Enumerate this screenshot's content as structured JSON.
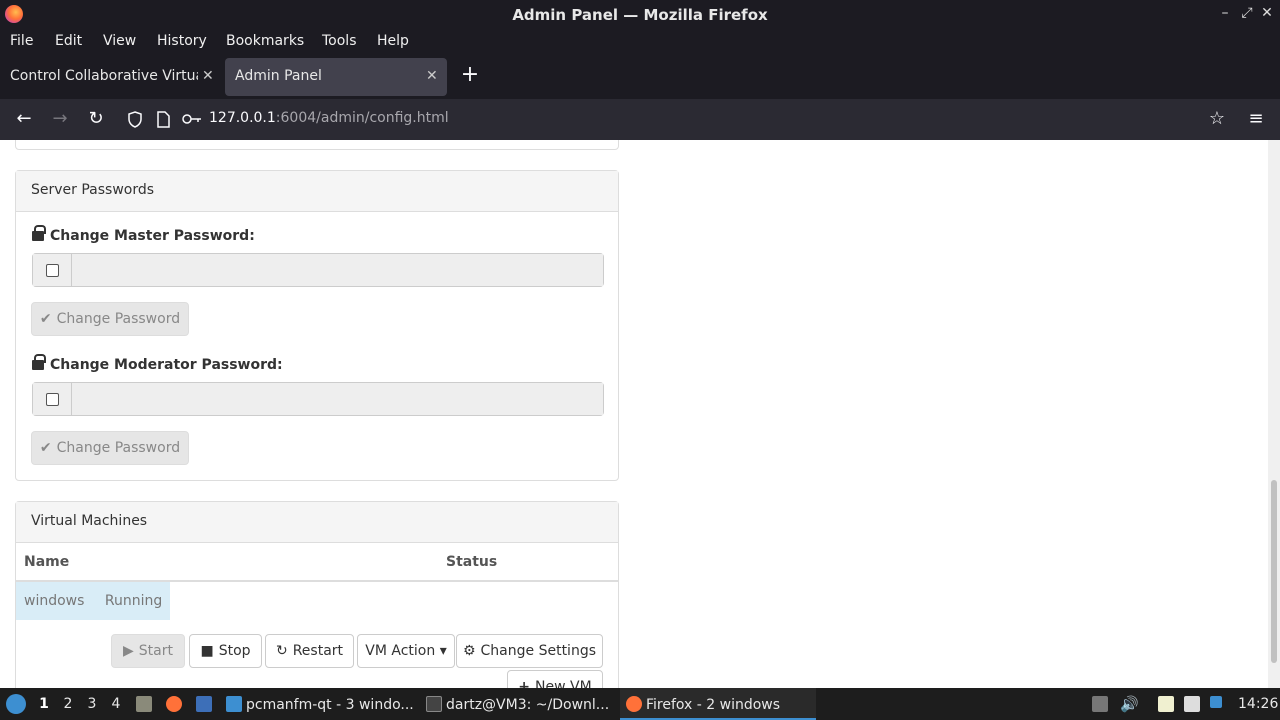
{
  "window": {
    "title": "Admin Panel — Mozilla Firefox",
    "minimize_glyph": "–",
    "maximize_glyph": "⤢",
    "close_glyph": "✕"
  },
  "menu": [
    "File",
    "Edit",
    "View",
    "History",
    "Bookmarks",
    "Tools",
    "Help"
  ],
  "tabs": [
    {
      "label": "Control Collaborative Virtual Machines",
      "close": "✕"
    },
    {
      "label": "Admin Panel",
      "close": "✕"
    }
  ],
  "new_tab_glyph": "+",
  "nav": {
    "back": "←",
    "forward": "→",
    "reload": "↻",
    "url_host": "127.0.0.1",
    "url_path": ":6004/admin/config.html",
    "bookmark_glyph": "☆",
    "menu_glyph": "≡"
  },
  "server_passwords": {
    "heading": "Server Passwords",
    "master_label": "Change Master Password:",
    "master_button": "Change Password",
    "moderator_label": "Change Moderator Password:",
    "moderator_button": "Change Password"
  },
  "virtual_machines": {
    "heading": "Virtual Machines",
    "columns": [
      "Name",
      "Status"
    ],
    "rows": [
      {
        "name": "windows",
        "status": "Running"
      }
    ],
    "buttons": {
      "start": "Start",
      "stop": "Stop",
      "restart": "Restart",
      "vm_action": "VM Action",
      "change_settings": "Change Settings",
      "new_vm": "New VM"
    }
  },
  "taskbar": {
    "desktops": [
      "1",
      "2",
      "3",
      "4"
    ],
    "windows": [
      {
        "label": "pcmanfm-qt - 3 windo..."
      },
      {
        "label": "dartz@VM3: ~/Downl..."
      },
      {
        "label": "Firefox - 2 windows"
      }
    ],
    "clock": "14:26"
  },
  "icons": {
    "check": "✔",
    "stop": "■",
    "restart": "↻",
    "start": "▶",
    "gear": "⚙",
    "plus": "+",
    "caret": "▾"
  }
}
